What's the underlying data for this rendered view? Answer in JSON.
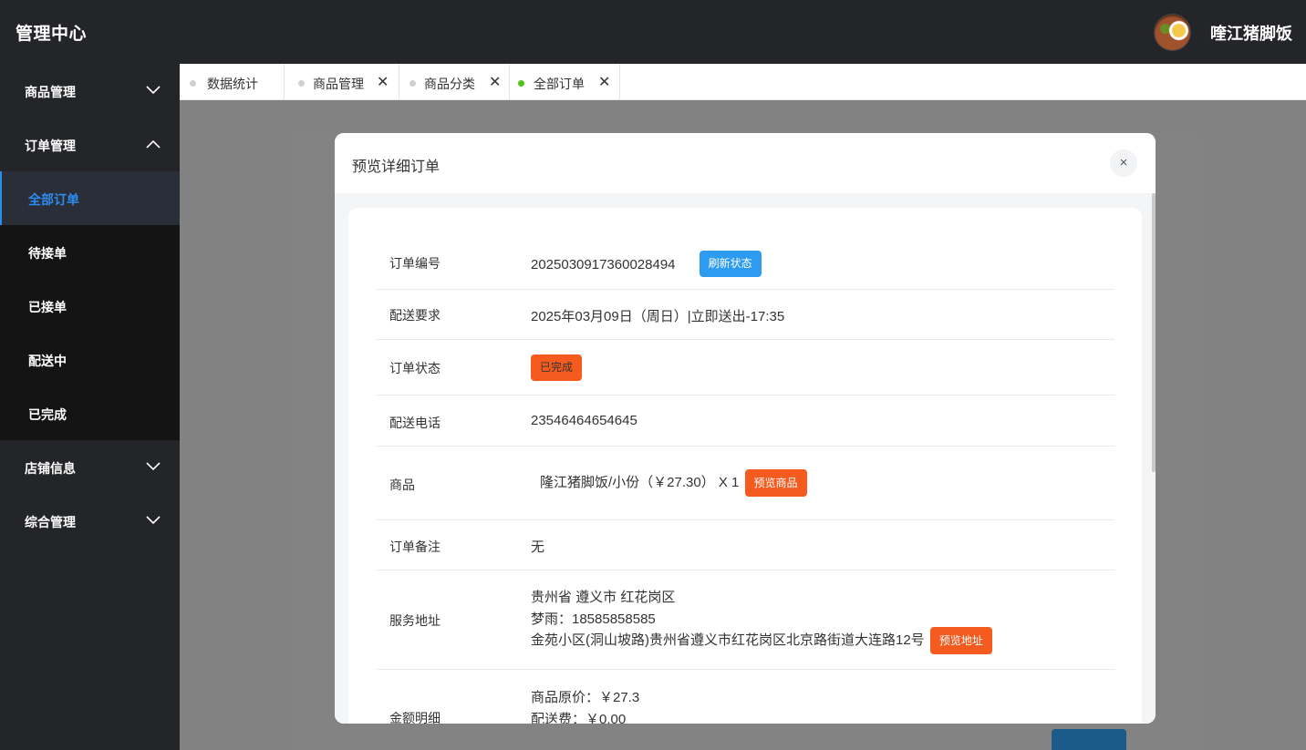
{
  "header": {
    "brand": "管理中心",
    "shop_name": "喹江猪脚饭"
  },
  "sidebar": {
    "menus": [
      {
        "label": "商品管理",
        "expanded": false
      },
      {
        "label": "订单管理",
        "expanded": true
      },
      {
        "label": "店铺信息",
        "expanded": false
      },
      {
        "label": "综合管理",
        "expanded": false
      }
    ],
    "order_submenu": [
      {
        "label": "全部订单",
        "active": true
      },
      {
        "label": "待接单"
      },
      {
        "label": "已接单"
      },
      {
        "label": "配送中"
      },
      {
        "label": "已完成"
      }
    ]
  },
  "tabs": [
    {
      "label": "数据统计",
      "closable": false,
      "active": false
    },
    {
      "label": "商品管理",
      "closable": true,
      "active": false
    },
    {
      "label": "商品分类",
      "closable": true,
      "active": false
    },
    {
      "label": "全部订单",
      "closable": true,
      "active": true
    }
  ],
  "modal": {
    "title": "预览详细订单",
    "close_icon": "×",
    "order_no_label": "订单编号",
    "order_no": "2025030917360028494",
    "refresh_button": "刷新状态",
    "delivery_req_label": "配送要求",
    "delivery_req": "2025年03月09日（周日）|立即送出-17:35",
    "status_label": "订单状态",
    "status": "已完成",
    "phone_label": "配送电话",
    "phone": "23546464654645",
    "goods_label": "商品",
    "goods": "隆江猪脚饭/小份（￥27.30） X 1",
    "preview_goods_button": "预览商品",
    "remark_label": "订单备注",
    "remark": "无",
    "address_label": "服务地址",
    "address_line1": "贵州省 遵义市 红花岗区",
    "address_line2": "梦雨：18585858585",
    "address_line3": "金苑小区(洞山坡路)贵州省遵义市红花岗区北京路街道大连路12号",
    "preview_address_button": "预览地址",
    "amount_label": "金额明细",
    "amount_line1": "商品原价：￥27.3",
    "amount_line2": "配送费：￥0.00"
  },
  "colors": {
    "accent": "#2d8cf0",
    "orange": "#f55a1e",
    "sidebar_bg": "#242528",
    "active_dot": "#52c41a"
  }
}
